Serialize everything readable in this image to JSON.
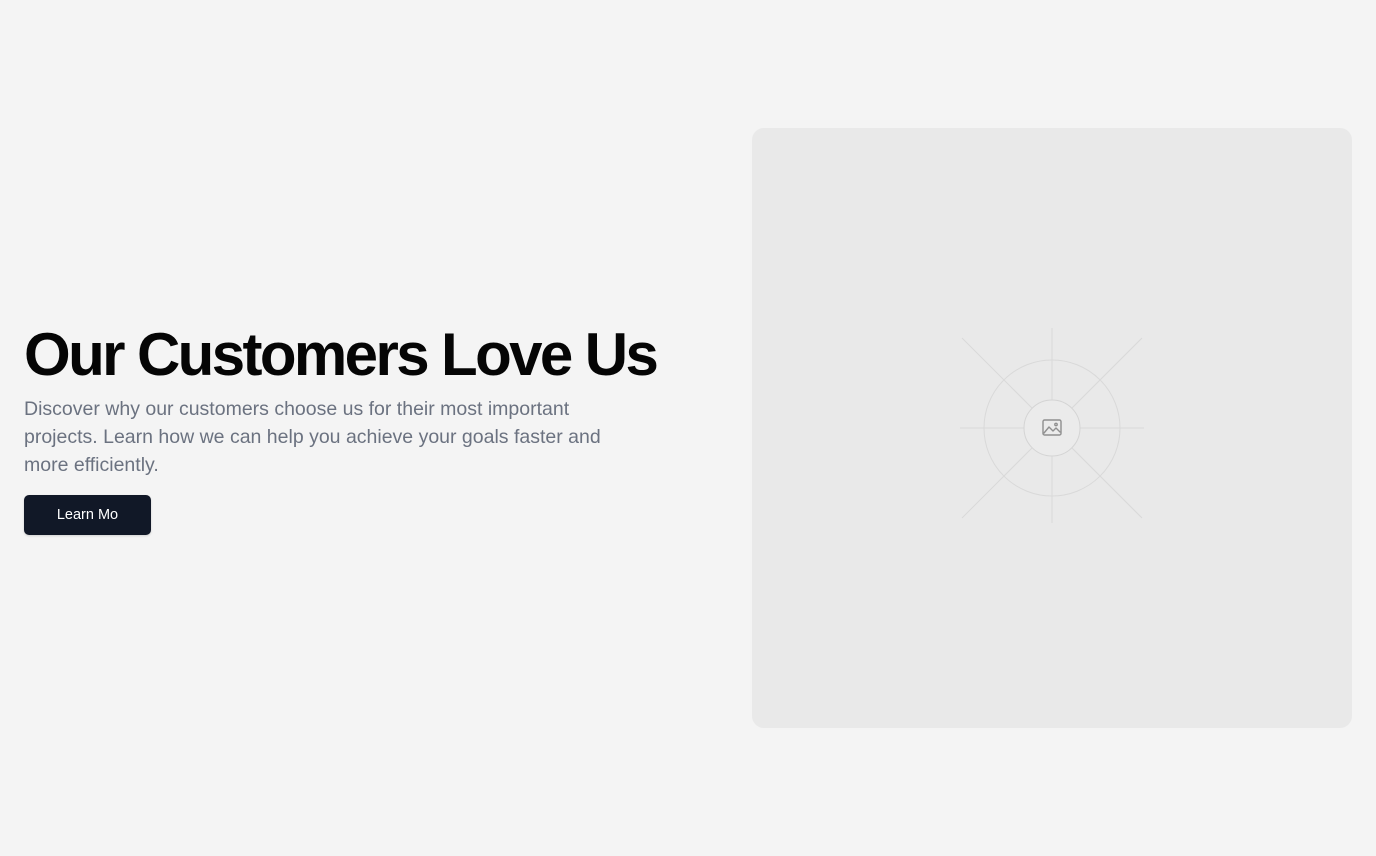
{
  "hero": {
    "title": "Our Customers Love Us",
    "subtitle": "Discover why our customers choose us for their most important projects. Learn how we can help you achieve your goals faster and more efficiently.",
    "cta_label": "Learn Mo"
  },
  "media": {
    "icon": "image-icon"
  },
  "colors": {
    "background": "#f4f4f4",
    "panel": "#e9e9e9",
    "button": "#111827",
    "subtitle_text": "#6b7280",
    "title_text": "#050505"
  }
}
